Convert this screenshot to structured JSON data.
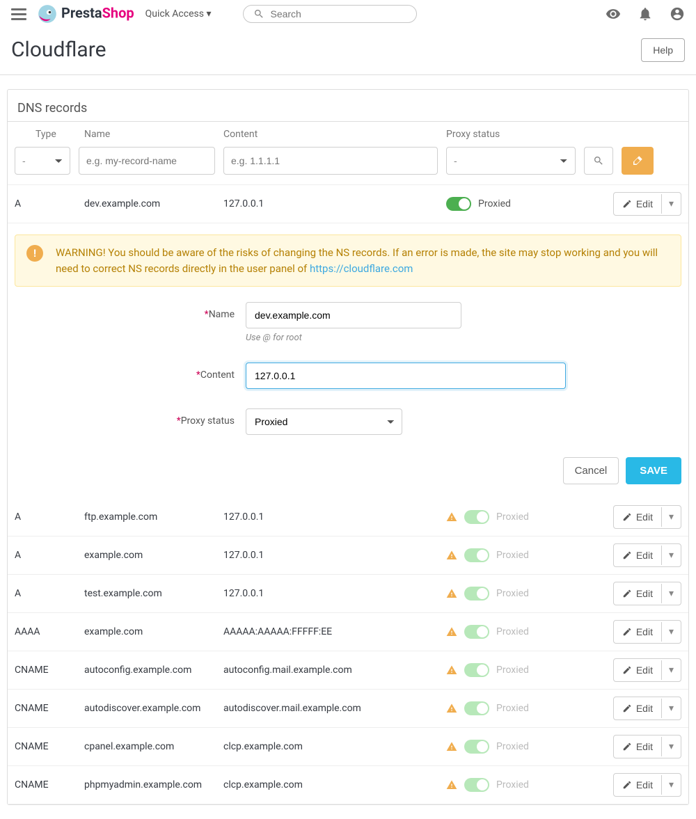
{
  "header": {
    "logo_presta": "Presta",
    "logo_shop": "Shop",
    "quick_access": "Quick Access",
    "search_placeholder": "Search"
  },
  "page": {
    "title": "Cloudflare",
    "help": "Help"
  },
  "panel": {
    "title": "DNS records"
  },
  "columns": {
    "type": "Type",
    "name": "Name",
    "content": "Content",
    "proxy": "Proxy status"
  },
  "filters": {
    "type_value": "-",
    "name_placeholder": "e.g. my-record-name",
    "content_placeholder": "e.g. 1.1.1.1",
    "proxy_value": "-"
  },
  "edit_label": "Edit",
  "proxied_label": "Proxied",
  "editing_row": {
    "type": "A",
    "name": "dev.example.com",
    "content": "127.0.0.1"
  },
  "alert": {
    "text_before_link": "WARNING! You should be aware of the risks of changing the NS records. If an error is made, the site may stop working and you will need to correct NS records directly in the user panel of ",
    "link_text": "https://cloudflare.com",
    "link_href": "https://cloudflare.com"
  },
  "form": {
    "name_label": "Name",
    "name_value": "dev.example.com",
    "name_hint": "Use @ for root",
    "content_label": "Content",
    "content_value": "127.0.0.1",
    "proxy_label": "Proxy status",
    "proxy_value": "Proxied",
    "cancel": "Cancel",
    "save": "SAVE"
  },
  "records": [
    {
      "type": "A",
      "name": "ftp.example.com",
      "content": "127.0.0.1",
      "proxy": "Proxied"
    },
    {
      "type": "A",
      "name": "example.com",
      "content": "127.0.0.1",
      "proxy": "Proxied"
    },
    {
      "type": "A",
      "name": "test.example.com",
      "content": "127.0.0.1",
      "proxy": "Proxied"
    },
    {
      "type": "AAAA",
      "name": "example.com",
      "content": "AAAAA:AAAAA:FFFFF:EE",
      "proxy": "Proxied"
    },
    {
      "type": "CNAME",
      "name": "autoconfig.example.com",
      "content": "autoconfig.mail.example.com",
      "proxy": "Proxied"
    },
    {
      "type": "CNAME",
      "name": "autodiscover.example.com",
      "content": "autodiscover.mail.example.com",
      "proxy": "Proxied"
    },
    {
      "type": "CNAME",
      "name": "cpanel.example.com",
      "content": "clcp.example.com",
      "proxy": "Proxied"
    },
    {
      "type": "CNAME",
      "name": "phpmyadmin.example.com",
      "content": "clcp.example.com",
      "proxy": "Proxied"
    }
  ]
}
